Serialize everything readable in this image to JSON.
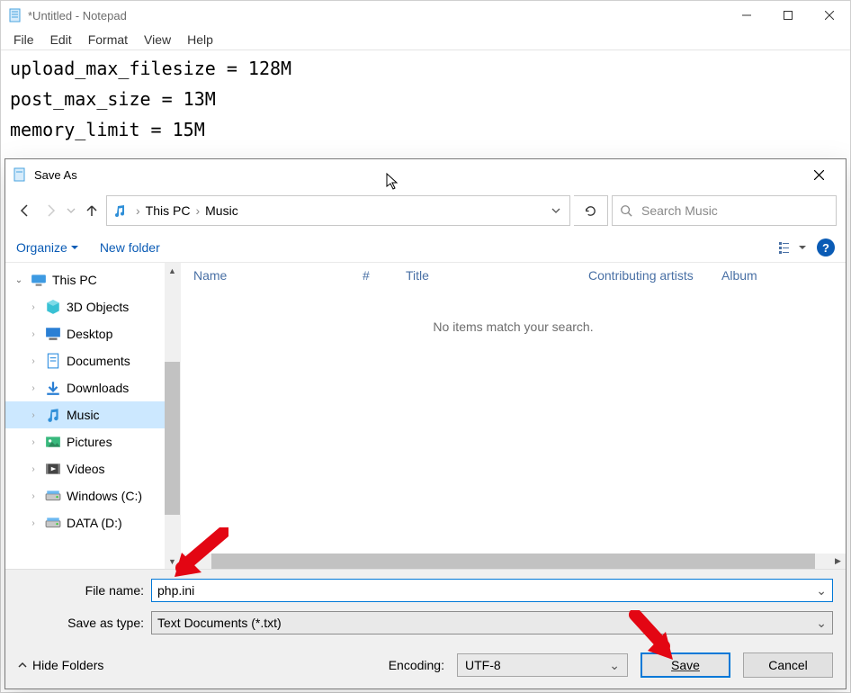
{
  "notepad": {
    "title": "*Untitled - Notepad",
    "menu": {
      "file": "File",
      "edit": "Edit",
      "format": "Format",
      "view": "View",
      "help": "Help"
    },
    "content": "upload_max_filesize = 128M\npost_max_size = 13M\nmemory_limit = 15M"
  },
  "dialog": {
    "title": "Save As",
    "breadcrumb": {
      "root": "This PC",
      "folder": "Music"
    },
    "search_placeholder": "Search Music",
    "toolbar": {
      "organize": "Organize",
      "newfolder": "New folder"
    },
    "columns": {
      "name": "Name",
      "num": "#",
      "title": "Title",
      "artists": "Contributing artists",
      "album": "Album"
    },
    "empty_msg": "No items match your search.",
    "tree": [
      {
        "label": "This PC",
        "depth": 0,
        "expanded": true,
        "icon": "pc"
      },
      {
        "label": "3D Objects",
        "depth": 1,
        "icon": "3d"
      },
      {
        "label": "Desktop",
        "depth": 1,
        "icon": "desktop"
      },
      {
        "label": "Documents",
        "depth": 1,
        "icon": "docs"
      },
      {
        "label": "Downloads",
        "depth": 1,
        "icon": "down"
      },
      {
        "label": "Music",
        "depth": 1,
        "icon": "music",
        "selected": true
      },
      {
        "label": "Pictures",
        "depth": 1,
        "icon": "pics"
      },
      {
        "label": "Videos",
        "depth": 1,
        "icon": "vids"
      },
      {
        "label": "Windows (C:)",
        "depth": 1,
        "icon": "drive"
      },
      {
        "label": "DATA (D:)",
        "depth": 1,
        "icon": "drive"
      }
    ],
    "filename_label": "File name:",
    "filename_value": "php.ini",
    "savetype_label": "Save as type:",
    "savetype_value": "Text Documents (*.txt)",
    "encoding_label": "Encoding:",
    "encoding_value": "UTF-8",
    "hide_folders": "Hide Folders",
    "save": "Save",
    "cancel": "Cancel"
  }
}
